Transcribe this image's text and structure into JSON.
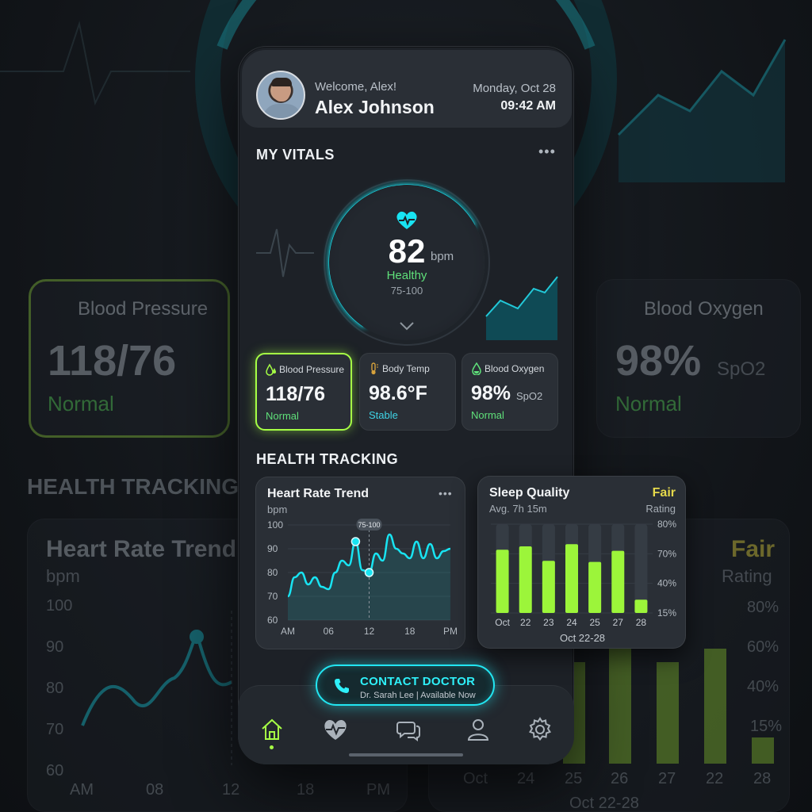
{
  "header": {
    "welcome": "Welcome, Alex!",
    "name": "Alex Johnson",
    "date": "Monday, Oct 28",
    "time": "09:42 AM"
  },
  "vitals": {
    "section_title": "MY VITALS",
    "heart_rate": {
      "value": "82",
      "unit": "bpm",
      "status": "Healthy",
      "range": "75-100",
      "level": 0.82
    },
    "cards": [
      {
        "label": "Blood Pressure",
        "value": "118/76",
        "unit": "",
        "status": "Normal",
        "status_color": "#5fe07a",
        "icon": "blood-drop-icon"
      },
      {
        "label": "Body Temp",
        "value": "98.6°F",
        "unit": "",
        "status": "Stable",
        "status_color": "#3fd3e6",
        "icon": "thermometer-icon"
      },
      {
        "label": "Blood Oxygen",
        "value": "98%",
        "unit": "SpO2",
        "status": "Normal",
        "status_color": "#5fe07a",
        "icon": "oxygen-drop-icon"
      }
    ]
  },
  "tracking": {
    "section_title": "HEALTH TRACKING",
    "heart_trend": {
      "title": "Heart Rate Trend",
      "subtitle": "bpm",
      "tooltip": "75-100"
    },
    "sleep": {
      "title": "Sleep Quality",
      "subtitle": "Avg. 7h 15m",
      "rating": "Fair",
      "rating_label": "Rating",
      "footer": "Oct 22-28"
    }
  },
  "chart_data": [
    {
      "type": "line",
      "title": "Heart Rate Trend",
      "ylabel": "bpm",
      "x_ticks": [
        "AM",
        "06",
        "12",
        "18",
        "PM"
      ],
      "y_ticks": [
        100,
        90,
        80,
        70,
        60
      ],
      "ylim": [
        60,
        100
      ],
      "x": [
        0,
        1,
        2,
        3,
        4,
        5,
        6,
        7,
        8,
        9,
        10,
        11,
        12,
        13,
        14,
        15,
        16,
        17,
        18,
        19,
        20,
        21,
        22,
        23,
        24
      ],
      "values": [
        70,
        78,
        80,
        75,
        78,
        74,
        73,
        80,
        85,
        83,
        93,
        81,
        80,
        88,
        85,
        96,
        90,
        88,
        86,
        93,
        86,
        92,
        86,
        89,
        90
      ],
      "highlights": [
        {
          "x": 10,
          "y": 93
        },
        {
          "x": 12,
          "y": 80
        }
      ]
    },
    {
      "type": "bar",
      "title": "Sleep Quality",
      "categories": [
        "Oct",
        "22",
        "23",
        "24",
        "25",
        "27",
        "28"
      ],
      "values": [
        57,
        60,
        47,
        62,
        46,
        56,
        12
      ],
      "y_ticks": [
        "80%",
        "70%",
        "40%",
        "15%"
      ],
      "ylim": [
        0,
        80
      ],
      "bar_color": "#9cf53a"
    }
  ],
  "contact": {
    "label": "CONTACT DOCTOR",
    "sub": "Dr. Sarah Lee | Available Now"
  },
  "nav": [
    "home-icon",
    "heart-pulse-icon",
    "chat-icon",
    "profile-icon",
    "settings-icon"
  ],
  "colors": {
    "accent": "#22e6f2",
    "green": "#a6ff45",
    "status_green": "#5fe07a"
  }
}
